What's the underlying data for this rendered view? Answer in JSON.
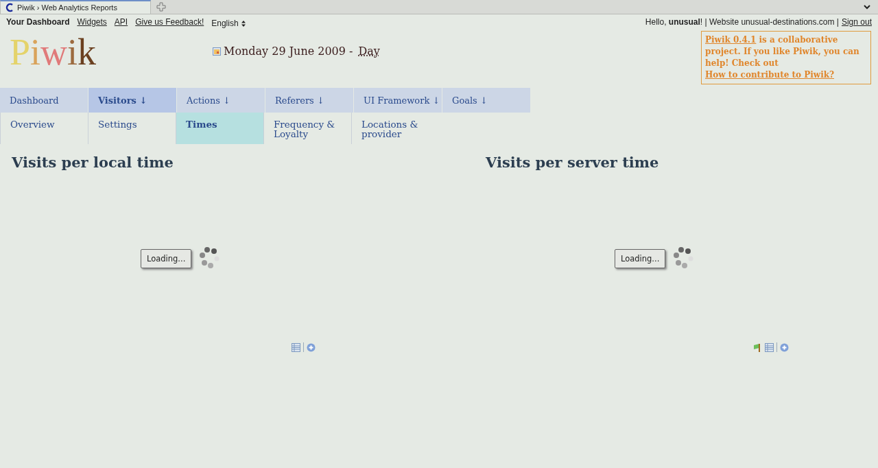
{
  "browser": {
    "tab_title": "Piwik › Web Analytics Reports"
  },
  "top_nav": {
    "items": [
      {
        "label": "Your Dashboard",
        "kind": "current"
      },
      {
        "label": "Widgets",
        "kind": "link"
      },
      {
        "label": "API",
        "kind": "link"
      },
      {
        "label": "Give us Feedback!",
        "kind": "link"
      },
      {
        "label": "English",
        "kind": "select"
      }
    ],
    "greeting": "Hello, **unusual**! | Website unusual-destinations.com |",
    "sign_out": "Sign out"
  },
  "logo": "Piwik",
  "date": {
    "text": "Monday 29 June 2009 -",
    "period": "Day"
  },
  "promo": [
    {
      "kind": "link",
      "text": "Piwik 0.4.1"
    },
    {
      "kind": "text",
      "text": " is a collaborative project. If you like Piwik, you can help! Check out "
    },
    {
      "kind": "link",
      "text": "How to contribute to Piwik?"
    }
  ],
  "menu": {
    "tabs": [
      {
        "label": "Dashboard",
        "selected": false
      },
      {
        "label": "Visitors ↓",
        "selected": true
      },
      {
        "label": "Actions ↓",
        "selected": false
      },
      {
        "label": "Referers ↓",
        "selected": false
      },
      {
        "label": "UI Framework ↓",
        "selected": false
      },
      {
        "label": "Goals ↓",
        "selected": false
      }
    ],
    "submenu": [
      {
        "label": "Overview",
        "selected": false
      },
      {
        "label": "Settings",
        "selected": false
      },
      {
        "label": "Times",
        "selected": true
      },
      {
        "label": "Frequency & Loyalty",
        "selected": false
      },
      {
        "label": "Locations & provider",
        "selected": false
      }
    ]
  },
  "widgets": [
    {
      "title": "Visits per local time",
      "loading": "Loading...",
      "footer_icons": [
        {
          "kind": "table"
        },
        {
          "kind": "plus"
        }
      ]
    },
    {
      "title": "Visits per server time",
      "loading": "Loading...",
      "footer_icons": [
        {
          "kind": "flag"
        },
        {
          "kind": "table"
        },
        {
          "kind": "plus"
        }
      ]
    }
  ]
}
